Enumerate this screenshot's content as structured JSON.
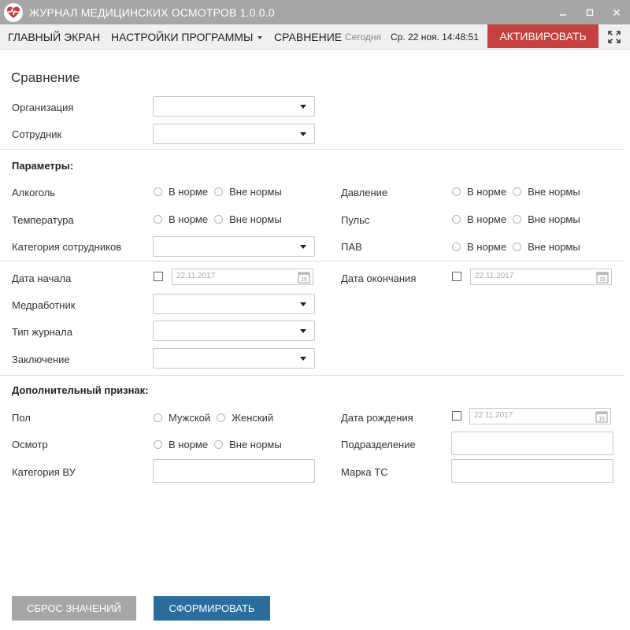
{
  "window": {
    "title": "ЖУРНАЛ МЕДИЦИНСКИХ ОСМОТРОВ 1.0.0.0"
  },
  "menu": {
    "main_screen": "ГЛАВНЫЙ ЭКРАН",
    "settings": "НАСТРОЙКИ ПРОГРАММЫ",
    "comparison": "СРАВНЕНИЕ",
    "today_label": "Сегодня",
    "datetime": "Ср. 22 ноя. 14:48:51",
    "activate": "АКТИВИРОВАТЬ"
  },
  "form": {
    "title": "Сравнение",
    "organization_label": "Организация",
    "employee_label": "Сотрудник",
    "params_header": "Параметры:",
    "alcohol_label": "Алкоголь",
    "temperature_label": "Температура",
    "employee_category_label": "Категория сотрудников",
    "pressure_label": "Давление",
    "pulse_label": "Пульс",
    "pav_label": "ПАВ",
    "normal": "В норме",
    "abnormal": "Вне нормы",
    "start_date_label": "Дата начала",
    "end_date_label": "Дата окончания",
    "date_placeholder": "22.11.2017",
    "calendar_day": "15",
    "medworker_label": "Медработник",
    "journal_type_label": "Тип журнала",
    "conclusion_label": "Заключение",
    "extra_header": "Дополнительный признак:",
    "sex_label": "Пол",
    "male": "Мужской",
    "female": "Женский",
    "birth_date_label": "Дата рождения",
    "exam_label": "Осмотр",
    "department_label": "Подразделение",
    "category_vu_label": "Категория ВУ",
    "vehicle_brand_label": "Марка ТС"
  },
  "buttons": {
    "reset": "СБРОС ЗНАЧЕНИЙ",
    "generate": "СФОРМИРОВАТЬ"
  },
  "colors": {
    "titlebar": "#a6a6a6",
    "activate": "#c74040",
    "generate": "#2b6e9e",
    "reset": "#a6a6a6"
  }
}
